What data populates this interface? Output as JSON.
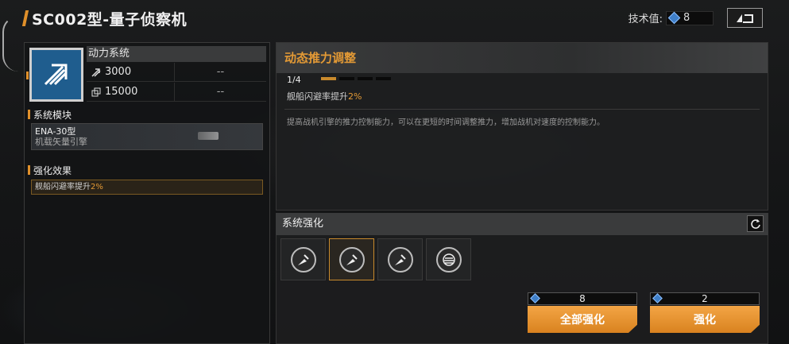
{
  "header": {
    "title": "SC002型-量子侦察机"
  },
  "tech": {
    "label": "技术值:",
    "value": "8"
  },
  "back_button": {
    "icon": "return-arrow-icon"
  },
  "left": {
    "system_name": "动力系统",
    "stats": [
      {
        "icon": "thrust-icon",
        "value": "3000",
        "extra": "--"
      },
      {
        "icon": "endurance-icon",
        "value": "15000",
        "extra": "--"
      }
    ],
    "module_section": "系统模块",
    "engine": {
      "name": "ENA-30型",
      "type": "机载矢量引擎"
    },
    "effect_section": "强化效果",
    "effect": {
      "text": "舰船闪避率提升",
      "value": "2%"
    }
  },
  "detail": {
    "title": "动态推力调整",
    "level": "1/4",
    "level_current": 1,
    "level_max": 4,
    "effect_text": "舰船闪避率提升",
    "effect_value": "2%",
    "description": "提高战机引擎的推力控制能力，可以在更短的时间调整推力，增加战机对速度的控制能力。"
  },
  "enhance": {
    "title": "系统强化",
    "slots": [
      {
        "icon": "thruster-skill-icon",
        "selected": false
      },
      {
        "icon": "thruster-skill-icon",
        "selected": true
      },
      {
        "icon": "thruster-skill-icon",
        "selected": false
      },
      {
        "icon": "stack-core-icon",
        "selected": false
      }
    ],
    "enhance_all": {
      "cost": "8",
      "label": "全部强化"
    },
    "enhance_one": {
      "cost": "2",
      "label": "强化"
    }
  },
  "colors": {
    "accent": "#e49a35",
    "button": "#e8952f",
    "gem": "#3f7fc8"
  }
}
